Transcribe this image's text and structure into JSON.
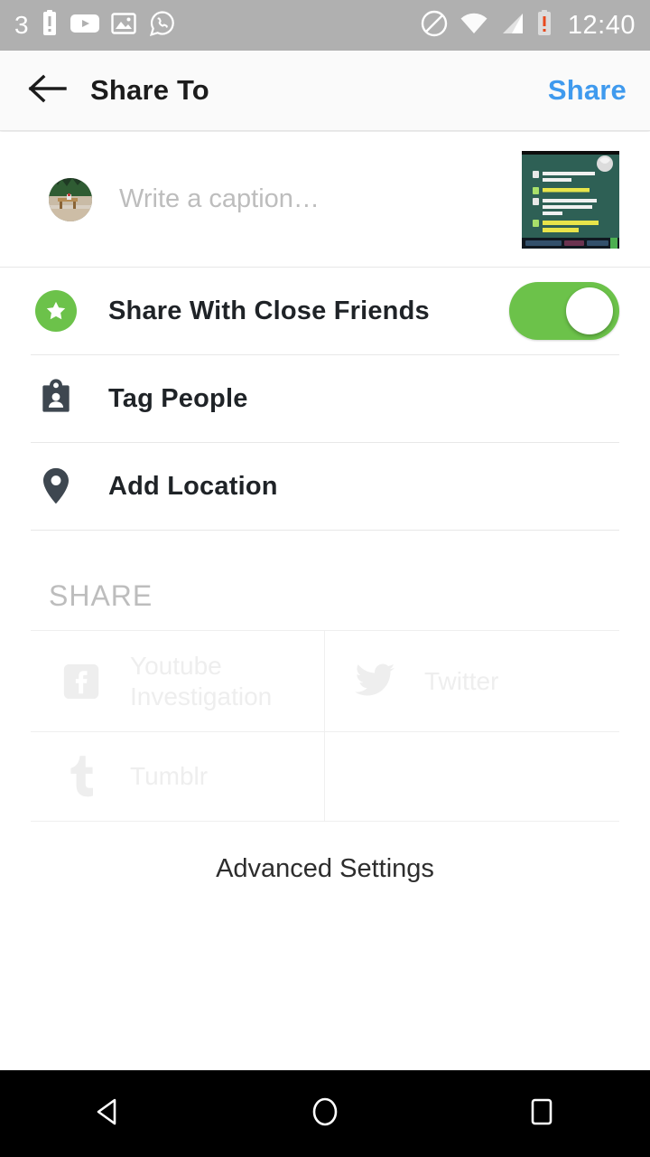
{
  "status_bar": {
    "notification_count": "3",
    "time": "12:40",
    "left_icons": [
      "battery-alert-icon",
      "youtube-icon",
      "image-icon",
      "whatsapp-icon"
    ],
    "right_icons": [
      "do-not-disturb-icon",
      "wifi-icon",
      "cellular-signal-icon",
      "battery-alert-icon"
    ],
    "background_color": "#b0b0b0",
    "foreground_color": "#ffffff"
  },
  "app_bar": {
    "back_label": "back-arrow",
    "title": "Share To",
    "action_label": "Share",
    "action_color": "#3f9aee"
  },
  "caption": {
    "placeholder": "Write a caption…",
    "value": "",
    "avatar_name": "user-avatar",
    "thumbnail_name": "post-thumbnail"
  },
  "options": [
    {
      "id": "close-friends",
      "label": "Share With Close Friends",
      "icon": "star-badge-icon",
      "icon_color": "#6cc24a",
      "toggle_on": true,
      "toggle_color": "#6cc24a"
    },
    {
      "id": "tag-people",
      "label": "Tag People",
      "icon": "tag-people-icon",
      "icon_color": "#3e4750"
    },
    {
      "id": "add-location",
      "label": "Add Location",
      "icon": "location-pin-icon",
      "icon_color": "#3e4750"
    }
  ],
  "share_section": {
    "header": "SHARE",
    "header_color": "#bdbdbd",
    "disabled_color": "#eeeeee",
    "targets": [
      {
        "id": "facebook",
        "label": "Youtube Investigation",
        "icon": "facebook-icon",
        "enabled": false
      },
      {
        "id": "twitter",
        "label": "Twitter",
        "icon": "twitter-icon",
        "enabled": false
      },
      {
        "id": "tumblr",
        "label": "Tumblr",
        "icon": "tumblr-icon",
        "enabled": false
      },
      {
        "id": "empty",
        "label": "",
        "icon": "",
        "enabled": false
      }
    ]
  },
  "advanced_settings": {
    "label": "Advanced Settings"
  },
  "nav_bar": {
    "background_color": "#000000",
    "buttons": [
      {
        "id": "back",
        "icon": "nav-back-triangle-icon"
      },
      {
        "id": "home",
        "icon": "nav-home-circle-icon"
      },
      {
        "id": "recents",
        "icon": "nav-recents-square-icon"
      }
    ]
  },
  "thumbnail_content": {
    "background_color": "#2e5f52",
    "lines": [
      "Pak saya mau ngelamar anak bapak",
      "Apa kelebihan kamu?",
      "Bisa ngelamar anak orang saya yang mampu naik mobil",
      "CARI PENGHULU NIKAH SEKARANG !!!"
    ]
  }
}
